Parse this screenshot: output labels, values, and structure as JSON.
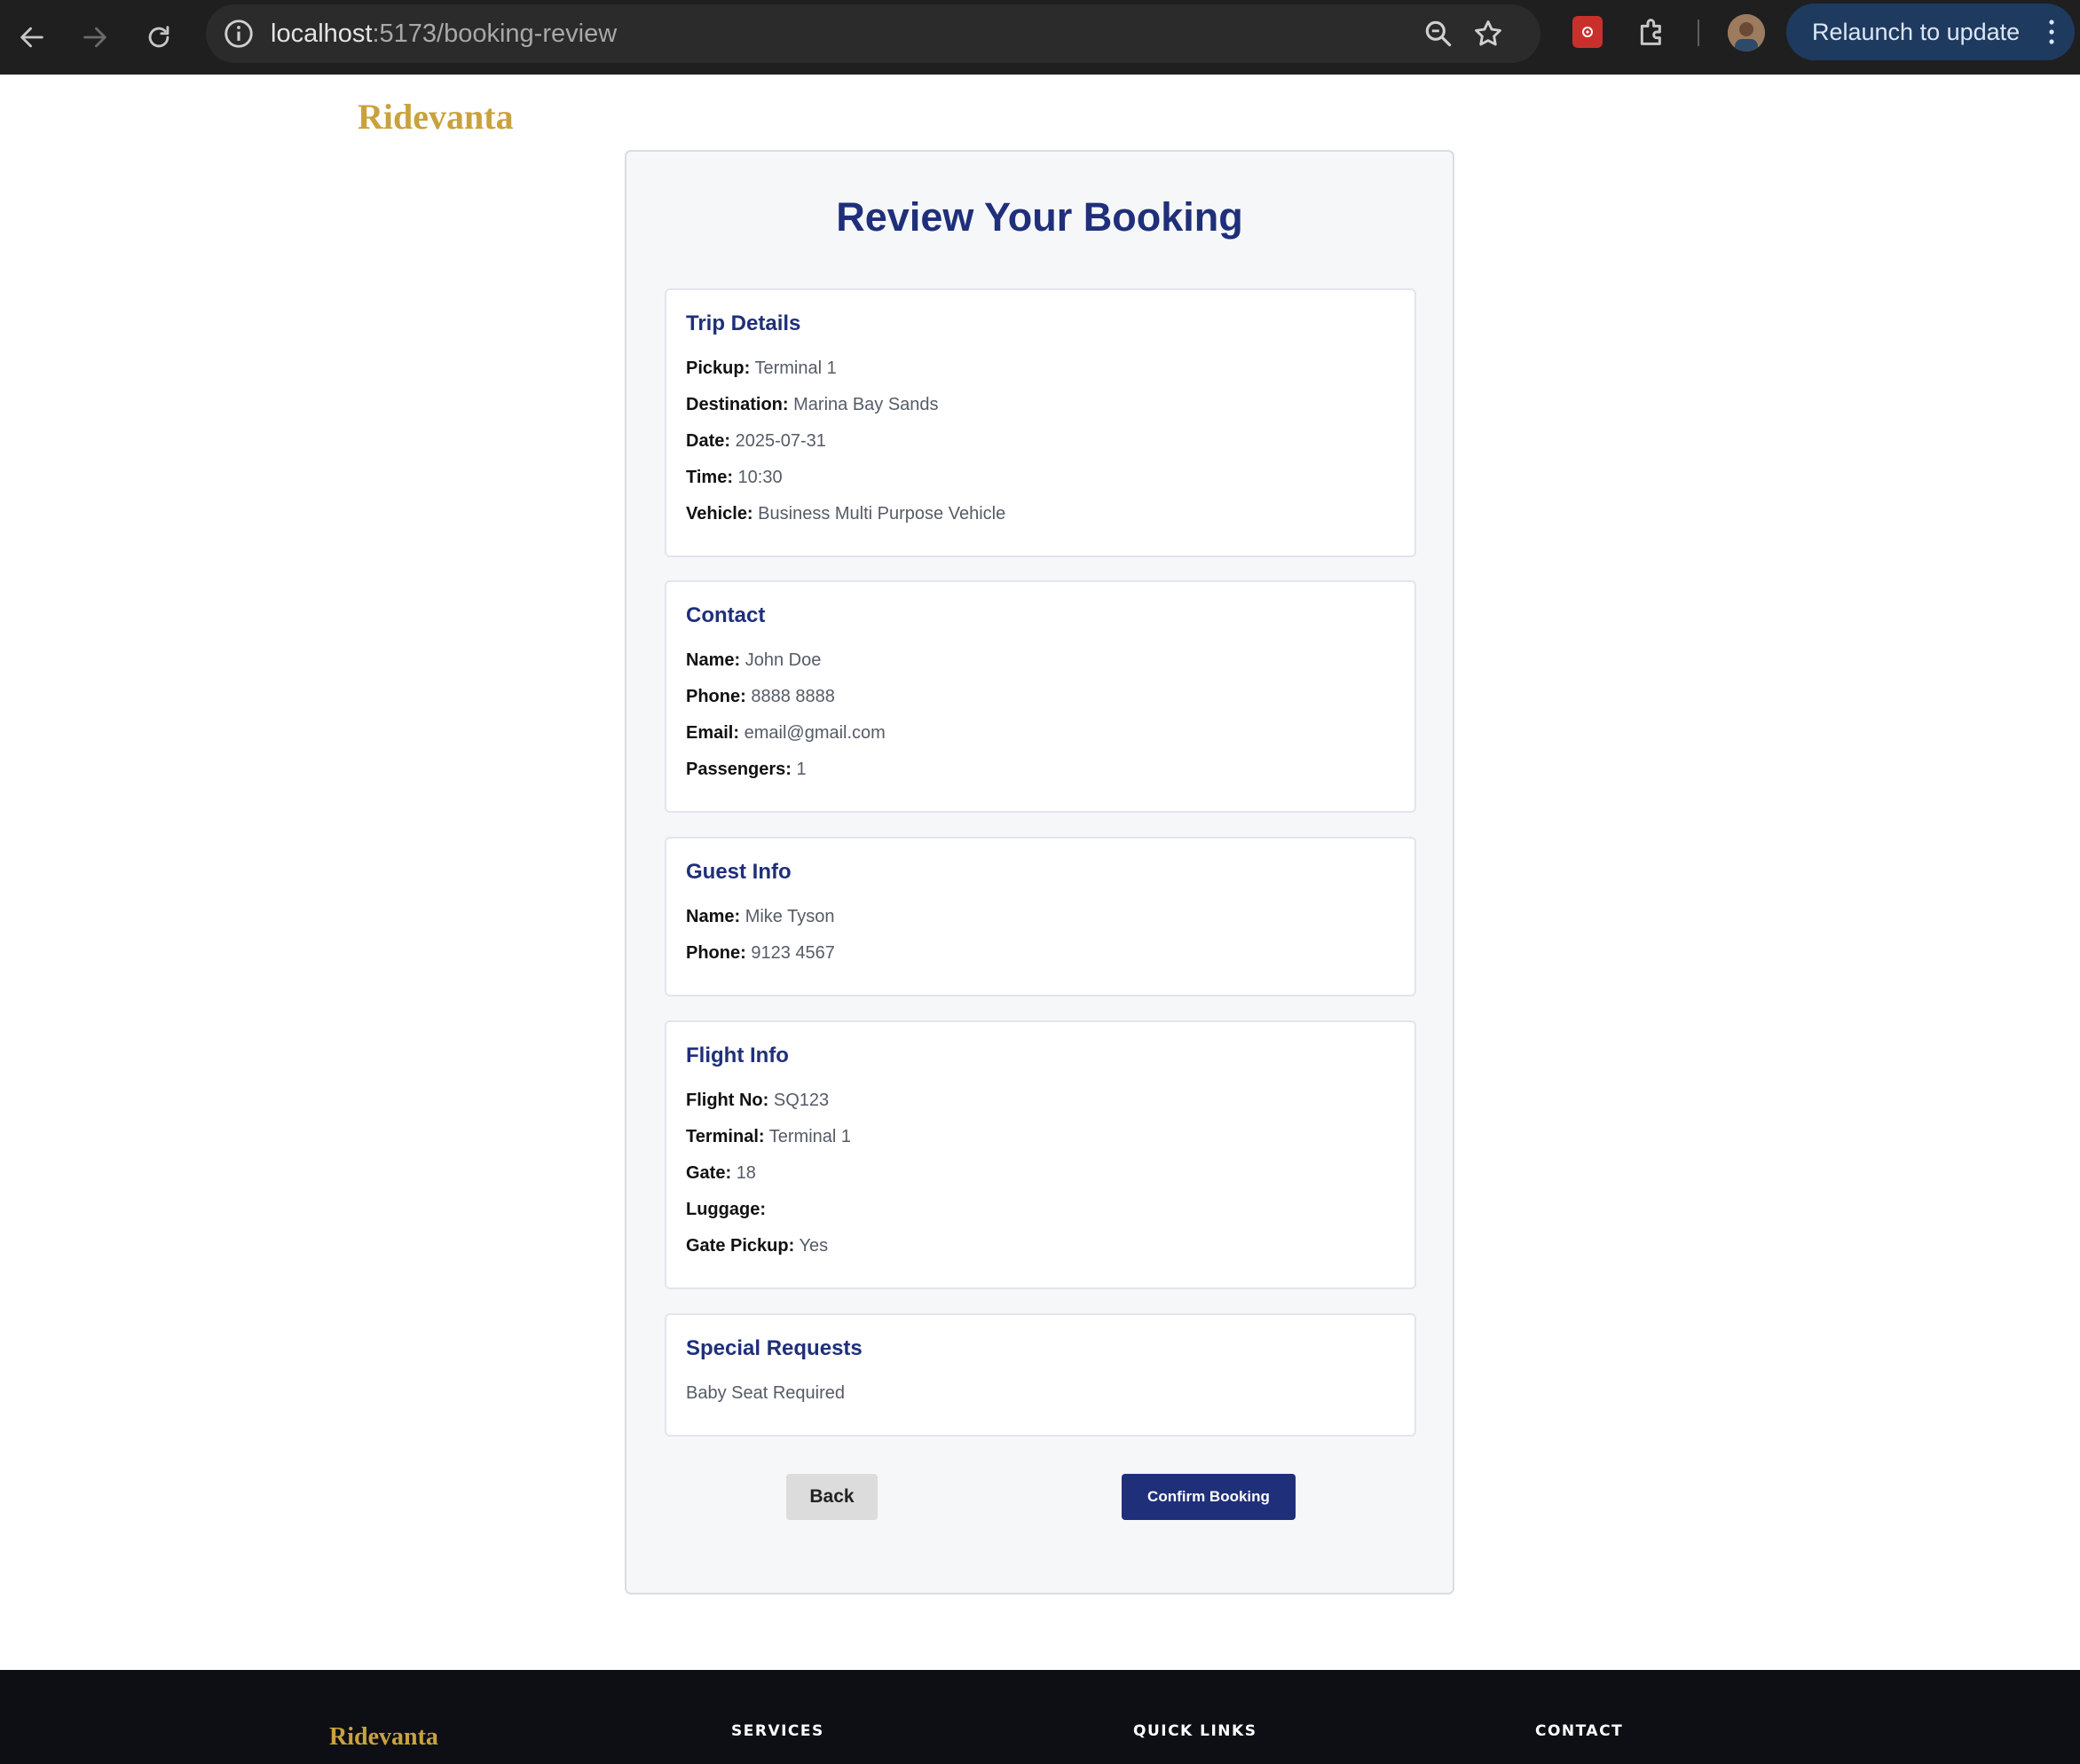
{
  "browser": {
    "url_host": "localhost",
    "url_path": ":5173/booking-review",
    "relaunch_label": "Relaunch to update"
  },
  "brand": "Ridevanta",
  "page": {
    "title": "Review Your Booking",
    "sections": {
      "trip": {
        "heading": "Trip Details",
        "rows": [
          {
            "label": "Pickup:",
            "value": "Terminal 1"
          },
          {
            "label": "Destination:",
            "value": "Marina Bay Sands"
          },
          {
            "label": "Date:",
            "value": "2025-07-31"
          },
          {
            "label": "Time:",
            "value": "10:30"
          },
          {
            "label": "Vehicle:",
            "value": "Business Multi Purpose Vehicle"
          }
        ]
      },
      "contact": {
        "heading": "Contact",
        "rows": [
          {
            "label": "Name:",
            "value": "John Doe"
          },
          {
            "label": "Phone:",
            "value": "8888 8888"
          },
          {
            "label": "Email:",
            "value": "email@gmail.com"
          },
          {
            "label": "Passengers:",
            "value": "1"
          }
        ]
      },
      "guest": {
        "heading": "Guest Info",
        "rows": [
          {
            "label": "Name:",
            "value": "Mike Tyson"
          },
          {
            "label": "Phone:",
            "value": "9123 4567"
          }
        ]
      },
      "flight": {
        "heading": "Flight Info",
        "rows": [
          {
            "label": "Flight No:",
            "value": "SQ123"
          },
          {
            "label": "Terminal:",
            "value": "Terminal 1"
          },
          {
            "label": "Gate:",
            "value": "18"
          },
          {
            "label": "Luggage:",
            "value": ""
          },
          {
            "label": "Gate Pickup:",
            "value": "Yes"
          }
        ]
      },
      "special": {
        "heading": "Special Requests",
        "text": "Baby Seat Required"
      }
    },
    "buttons": {
      "back": "Back",
      "confirm": "Confirm Booking"
    }
  },
  "footer": {
    "brand": "Ridevanta",
    "columns": [
      "SERVICES",
      "QUICK LINKS",
      "CONTACT"
    ]
  }
}
